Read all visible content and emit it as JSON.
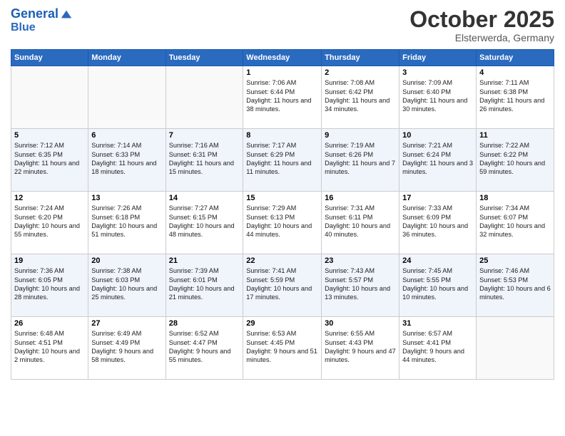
{
  "header": {
    "logo_line1": "General",
    "logo_line2": "Blue",
    "title": "October 2025",
    "subtitle": "Elsterwerda, Germany"
  },
  "days_of_week": [
    "Sunday",
    "Monday",
    "Tuesday",
    "Wednesday",
    "Thursday",
    "Friday",
    "Saturday"
  ],
  "weeks": [
    [
      {
        "day": "",
        "info": ""
      },
      {
        "day": "",
        "info": ""
      },
      {
        "day": "",
        "info": ""
      },
      {
        "day": "1",
        "info": "Sunrise: 7:06 AM\nSunset: 6:44 PM\nDaylight: 11 hours\nand 38 minutes."
      },
      {
        "day": "2",
        "info": "Sunrise: 7:08 AM\nSunset: 6:42 PM\nDaylight: 11 hours\nand 34 minutes."
      },
      {
        "day": "3",
        "info": "Sunrise: 7:09 AM\nSunset: 6:40 PM\nDaylight: 11 hours\nand 30 minutes."
      },
      {
        "day": "4",
        "info": "Sunrise: 7:11 AM\nSunset: 6:38 PM\nDaylight: 11 hours\nand 26 minutes."
      }
    ],
    [
      {
        "day": "5",
        "info": "Sunrise: 7:12 AM\nSunset: 6:35 PM\nDaylight: 11 hours\nand 22 minutes."
      },
      {
        "day": "6",
        "info": "Sunrise: 7:14 AM\nSunset: 6:33 PM\nDaylight: 11 hours\nand 18 minutes."
      },
      {
        "day": "7",
        "info": "Sunrise: 7:16 AM\nSunset: 6:31 PM\nDaylight: 11 hours\nand 15 minutes."
      },
      {
        "day": "8",
        "info": "Sunrise: 7:17 AM\nSunset: 6:29 PM\nDaylight: 11 hours\nand 11 minutes."
      },
      {
        "day": "9",
        "info": "Sunrise: 7:19 AM\nSunset: 6:26 PM\nDaylight: 11 hours\nand 7 minutes."
      },
      {
        "day": "10",
        "info": "Sunrise: 7:21 AM\nSunset: 6:24 PM\nDaylight: 11 hours\nand 3 minutes."
      },
      {
        "day": "11",
        "info": "Sunrise: 7:22 AM\nSunset: 6:22 PM\nDaylight: 10 hours\nand 59 minutes."
      }
    ],
    [
      {
        "day": "12",
        "info": "Sunrise: 7:24 AM\nSunset: 6:20 PM\nDaylight: 10 hours\nand 55 minutes."
      },
      {
        "day": "13",
        "info": "Sunrise: 7:26 AM\nSunset: 6:18 PM\nDaylight: 10 hours\nand 51 minutes."
      },
      {
        "day": "14",
        "info": "Sunrise: 7:27 AM\nSunset: 6:15 PM\nDaylight: 10 hours\nand 48 minutes."
      },
      {
        "day": "15",
        "info": "Sunrise: 7:29 AM\nSunset: 6:13 PM\nDaylight: 10 hours\nand 44 minutes."
      },
      {
        "day": "16",
        "info": "Sunrise: 7:31 AM\nSunset: 6:11 PM\nDaylight: 10 hours\nand 40 minutes."
      },
      {
        "day": "17",
        "info": "Sunrise: 7:33 AM\nSunset: 6:09 PM\nDaylight: 10 hours\nand 36 minutes."
      },
      {
        "day": "18",
        "info": "Sunrise: 7:34 AM\nSunset: 6:07 PM\nDaylight: 10 hours\nand 32 minutes."
      }
    ],
    [
      {
        "day": "19",
        "info": "Sunrise: 7:36 AM\nSunset: 6:05 PM\nDaylight: 10 hours\nand 28 minutes."
      },
      {
        "day": "20",
        "info": "Sunrise: 7:38 AM\nSunset: 6:03 PM\nDaylight: 10 hours\nand 25 minutes."
      },
      {
        "day": "21",
        "info": "Sunrise: 7:39 AM\nSunset: 6:01 PM\nDaylight: 10 hours\nand 21 minutes."
      },
      {
        "day": "22",
        "info": "Sunrise: 7:41 AM\nSunset: 5:59 PM\nDaylight: 10 hours\nand 17 minutes."
      },
      {
        "day": "23",
        "info": "Sunrise: 7:43 AM\nSunset: 5:57 PM\nDaylight: 10 hours\nand 13 minutes."
      },
      {
        "day": "24",
        "info": "Sunrise: 7:45 AM\nSunset: 5:55 PM\nDaylight: 10 hours\nand 10 minutes."
      },
      {
        "day": "25",
        "info": "Sunrise: 7:46 AM\nSunset: 5:53 PM\nDaylight: 10 hours\nand 6 minutes."
      }
    ],
    [
      {
        "day": "26",
        "info": "Sunrise: 6:48 AM\nSunset: 4:51 PM\nDaylight: 10 hours\nand 2 minutes."
      },
      {
        "day": "27",
        "info": "Sunrise: 6:49 AM\nSunset: 4:49 PM\nDaylight: 9 hours\nand 58 minutes."
      },
      {
        "day": "28",
        "info": "Sunrise: 6:52 AM\nSunset: 4:47 PM\nDaylight: 9 hours\nand 55 minutes."
      },
      {
        "day": "29",
        "info": "Sunrise: 6:53 AM\nSunset: 4:45 PM\nDaylight: 9 hours\nand 51 minutes."
      },
      {
        "day": "30",
        "info": "Sunrise: 6:55 AM\nSunset: 4:43 PM\nDaylight: 9 hours\nand 47 minutes."
      },
      {
        "day": "31",
        "info": "Sunrise: 6:57 AM\nSunset: 4:41 PM\nDaylight: 9 hours\nand 44 minutes."
      },
      {
        "day": "",
        "info": ""
      }
    ]
  ]
}
